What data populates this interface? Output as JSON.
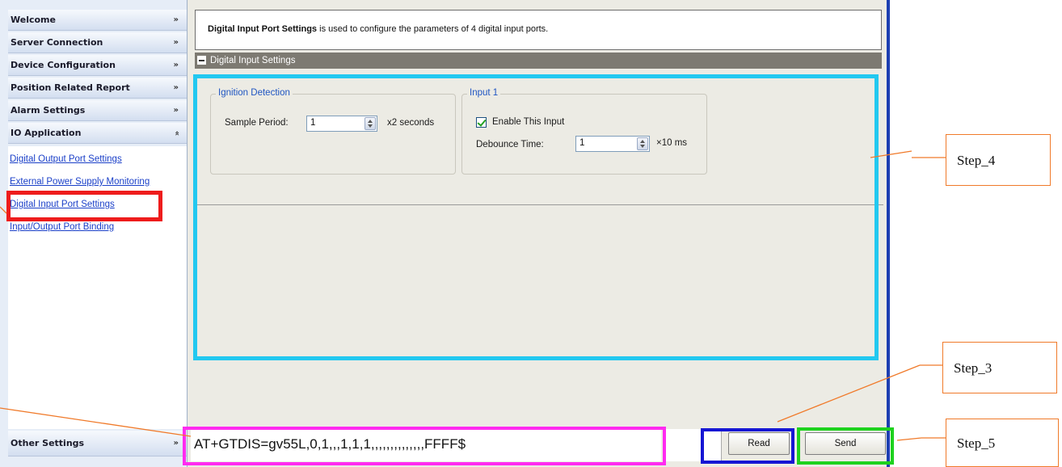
{
  "sidebar": {
    "headers": [
      {
        "label": "Welcome",
        "chevron": "double-chevron-down-icon"
      },
      {
        "label": "Server Connection",
        "chevron": "double-chevron-down-icon"
      },
      {
        "label": "Device Configuration",
        "chevron": "double-chevron-down-icon"
      },
      {
        "label": "Position Related Report",
        "chevron": "double-chevron-down-icon"
      },
      {
        "label": "Alarm Settings",
        "chevron": "double-chevron-down-icon"
      },
      {
        "label": "IO Application",
        "chevron": "double-chevron-up-icon"
      }
    ],
    "io_links": [
      "Digital Output Port Settings",
      "External Power Supply Monitoring",
      "Digital Input Port Settings",
      "Input/Output Port Binding"
    ],
    "selected_link": "Digital Input Port Settings",
    "footer_header": {
      "label": "Other Settings",
      "chevron": "double-chevron-down-icon"
    }
  },
  "main": {
    "description_bold": "Digital Input Port Settings",
    "description_rest": " is used to configure the parameters of 4 digital input ports.",
    "section_title": "Digital Input Settings",
    "ignition": {
      "title": "Ignition Detection",
      "sample_period_label": "Sample Period:",
      "sample_period_value": "1",
      "sample_period_unit": "x2 seconds"
    },
    "input1": {
      "title": "Input 1",
      "enable_label": "Enable This Input",
      "enable_checked": true,
      "debounce_label": "Debounce Time:",
      "debounce_value": "1",
      "debounce_unit": "×10 ms"
    }
  },
  "command": {
    "text": "AT+GTDIS=gv55L,0,1,,,1,1,1,,,,,,,,,,,,,,FFFF$",
    "read_label": "Read",
    "send_label": "Send"
  },
  "annotations": {
    "step4": "Step_4",
    "step3": "Step_3",
    "step5": "Step_5"
  },
  "colors": {
    "link": "#1a3fc8",
    "highlight_red": "#ee1c1c",
    "highlight_cyan": "#22c8f0",
    "highlight_magenta": "#ff2bf0",
    "highlight_blue": "#1616d4",
    "highlight_green": "#1ed21e",
    "callout_orange": "#f07a2a"
  }
}
